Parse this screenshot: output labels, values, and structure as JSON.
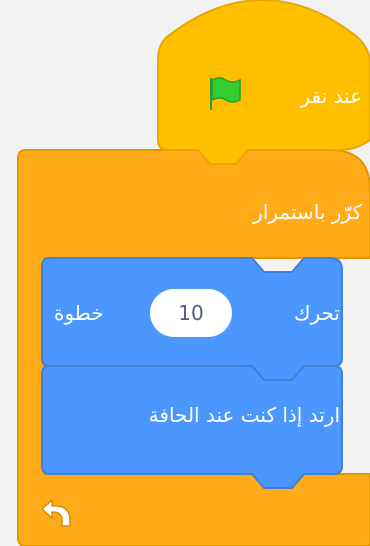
{
  "blocks": {
    "hat": {
      "label": "عند نقر",
      "icon": "green-flag-icon",
      "color": "#ffbf00",
      "border_color": "#e6a800"
    },
    "forever": {
      "label": "كرّر باستمرار",
      "icon": "loop-arrow-icon",
      "color": "#ffab19",
      "border_color": "#e69500"
    },
    "move": {
      "label_before": "تحرك",
      "steps_value": "10",
      "label_after": "خطوة",
      "color": "#4c97ff",
      "border_color": "#4280d7"
    },
    "bounce": {
      "label": "ارتد إذا كنت عند الحافة",
      "color": "#4c97ff",
      "border_color": "#4280d7"
    }
  },
  "colors": {
    "background": "#f2f2f2",
    "flag": "#33cc33"
  }
}
